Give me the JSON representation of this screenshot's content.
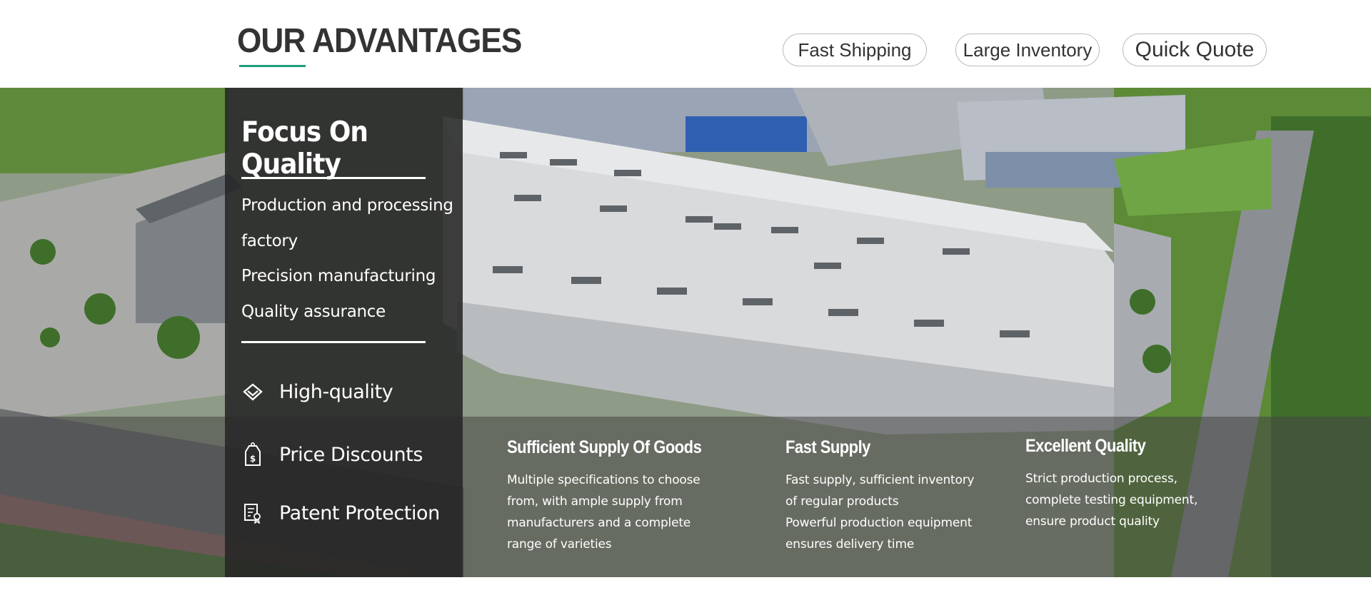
{
  "header": {
    "title": "OUR ADVANTAGES",
    "tabs": [
      {
        "label": "Fast Shipping"
      },
      {
        "label": "Large Inventory"
      },
      {
        "label": "Quick Quote"
      }
    ]
  },
  "panel": {
    "title": "Focus On Quality",
    "lines": [
      "Production and processing",
      "factory",
      "Precision manufacturing",
      "Quality assurance"
    ],
    "features": [
      {
        "label": "High-quality",
        "icon": "diamond-icon"
      },
      {
        "label": "Price Discounts",
        "icon": "price-tag-icon"
      },
      {
        "label": "Patent Protection",
        "icon": "patent-document-icon"
      }
    ]
  },
  "columns": [
    {
      "title": "Sufficient Supply Of Goods",
      "body": [
        "Multiple specifications to choose",
        "from, with ample supply from",
        "manufacturers and a complete",
        "range of varieties"
      ]
    },
    {
      "title": "Fast Supply",
      "body": [
        "Fast supply, sufficient inventory",
        "of regular products",
        "Powerful production equipment",
        "ensures delivery time"
      ]
    },
    {
      "title": "Excellent Quality",
      "body": [
        "Strict production process,",
        "complete testing equipment,",
        "ensure product quality"
      ]
    }
  ],
  "colors": {
    "accent": "#1e9d7b",
    "panel": "#262626",
    "text": "#333333"
  }
}
